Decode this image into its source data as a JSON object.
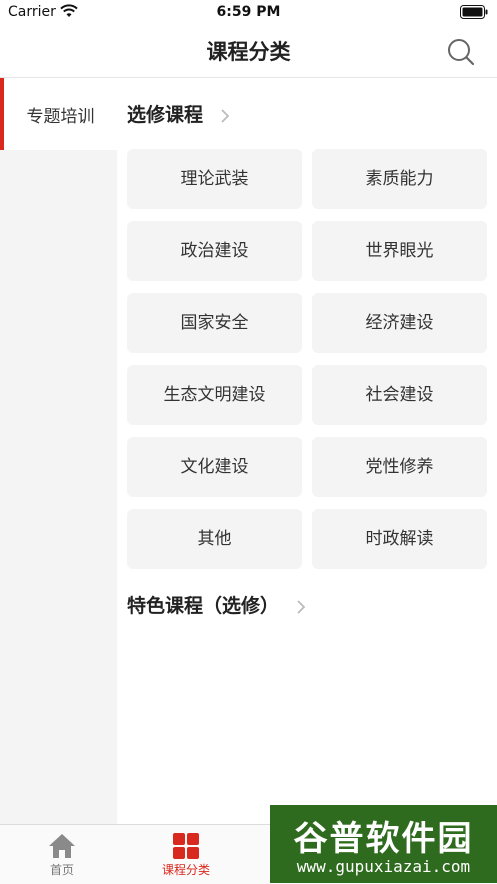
{
  "status_bar": {
    "carrier": "Carrier",
    "time": "6:59 PM"
  },
  "nav": {
    "title": "课程分类",
    "search_icon": "search-icon"
  },
  "sidebar": {
    "items": [
      {
        "label": "专题培训",
        "selected": true
      }
    ]
  },
  "sections": [
    {
      "title": "选修课程",
      "items": [
        "理论武装",
        "素质能力",
        "政治建设",
        "世界眼光",
        "国家安全",
        "经济建设",
        "生态文明建设",
        "社会建设",
        "文化建设",
        "党性修养",
        "其他",
        "时政解读"
      ]
    },
    {
      "title": "特色课程（选修）",
      "items": []
    }
  ],
  "tab_bar": {
    "tabs": [
      {
        "label": "首页",
        "icon": "home-icon",
        "selected": false
      },
      {
        "label": "课程分类",
        "icon": "category-grid-icon",
        "selected": true
      }
    ]
  },
  "watermark": {
    "logo_text": "谷普软件园",
    "url": "www.gupuxiazai.com"
  },
  "colors": {
    "accent": "#d9281d",
    "sidebar_bg": "#f4f4f4",
    "tile_bg": "#f4f4f4",
    "watermark_bg": "#2f6b1e"
  }
}
